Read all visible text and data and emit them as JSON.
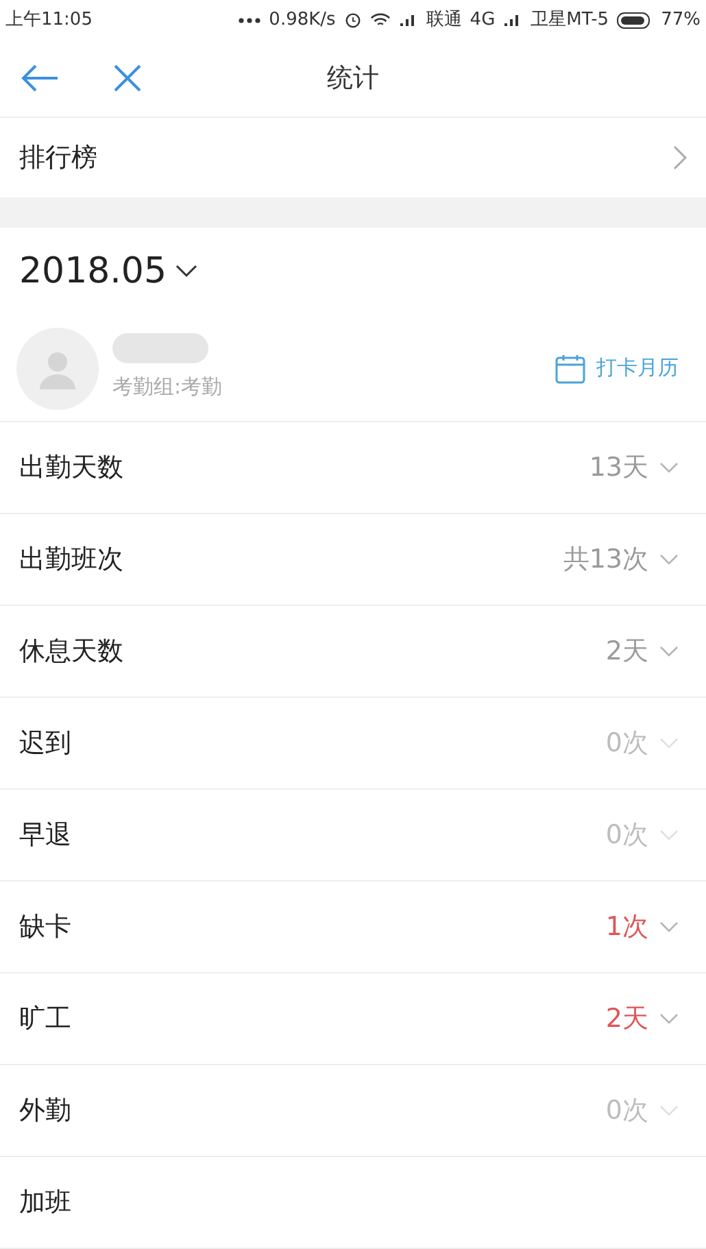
{
  "status_bar": {
    "time": "上午11:05",
    "speed": "0.98K/s",
    "carrier_1": "联通",
    "network": "4G",
    "carrier_2": "卫星MT-5",
    "battery": "77%"
  },
  "nav": {
    "title": "统计"
  },
  "ranking": {
    "label": "排行榜"
  },
  "month": {
    "label": "2018.05"
  },
  "profile": {
    "group": "考勤组:考勤",
    "calendar_link": "打卡月历"
  },
  "rows": [
    {
      "label": "出勤天数",
      "value": "13天",
      "kind": "normal"
    },
    {
      "label": "出勤班次",
      "value": "共13次",
      "kind": "normal"
    },
    {
      "label": "休息天数",
      "value": "2天",
      "kind": "normal"
    },
    {
      "label": "迟到",
      "value": "0次",
      "kind": "zero"
    },
    {
      "label": "早退",
      "value": "0次",
      "kind": "zero"
    },
    {
      "label": "缺卡",
      "value": "1次",
      "kind": "alert"
    },
    {
      "label": "旷工",
      "value": "2天",
      "kind": "alert"
    },
    {
      "label": "外勤",
      "value": "0次",
      "kind": "zero"
    },
    {
      "label": "加班"
    }
  ]
}
